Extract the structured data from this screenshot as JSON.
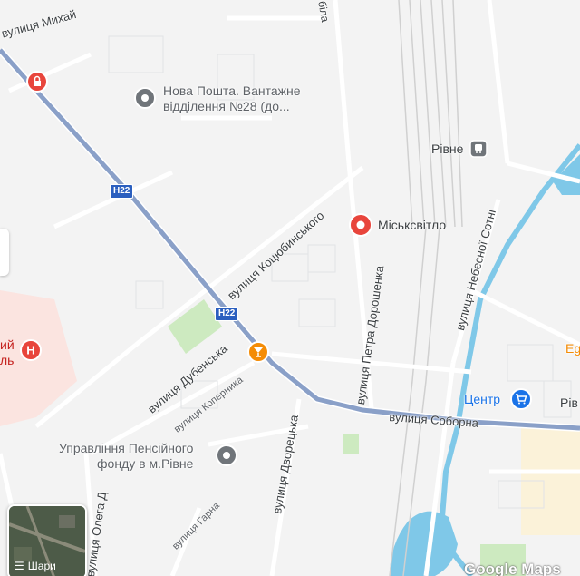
{
  "map": {
    "streets": {
      "mykhailo": "вулиця Михай",
      "kotsiubynskoho": "вулиця Коцюбинського",
      "dubenska": "вулиця Дубенська",
      "kopernyka": "вулиця Коперника",
      "dvoretska": "вулиця Дворецька",
      "petra_doroshenka": "вулиця Петра Дорошенка",
      "soborna": "вулиця Соборна",
      "nebesnoi_sotni": "вулиця Небесної Сотні",
      "harna": "вулиця Гарна",
      "olega": "вулиця Олега Д",
      "top_fragment": "біла"
    },
    "route_shields": [
      "H22",
      "H22"
    ],
    "pois": {
      "nova_poshta": [
        "Нова Пошта. Вантажне",
        "відділення №28 (до..."
      ],
      "miskysvitlo": "Міськсвітло",
      "rivne_station": "Рівне",
      "tsentr": "Центр",
      "pension_fund": [
        "Управління Пенсійного",
        "фонду в м.Рівне"
      ],
      "hospital_fragment": [
        "ий",
        "ль"
      ],
      "right_fragment": "Рів",
      "eg_fragment": "Eg"
    },
    "layers_button": {
      "label": "Шари"
    },
    "google_logo": "Google Maps",
    "colors": {
      "background": "#f3f3f3",
      "highway": "#8aa0c8",
      "water": "#7fc8e8",
      "park": "#cdeac0",
      "hospital": "#fbe4e0",
      "poi_red": "#e8453c",
      "poi_blue": "#1a73e8",
      "poi_orange": "#f48c06",
      "poi_gray": "#70757a"
    }
  }
}
